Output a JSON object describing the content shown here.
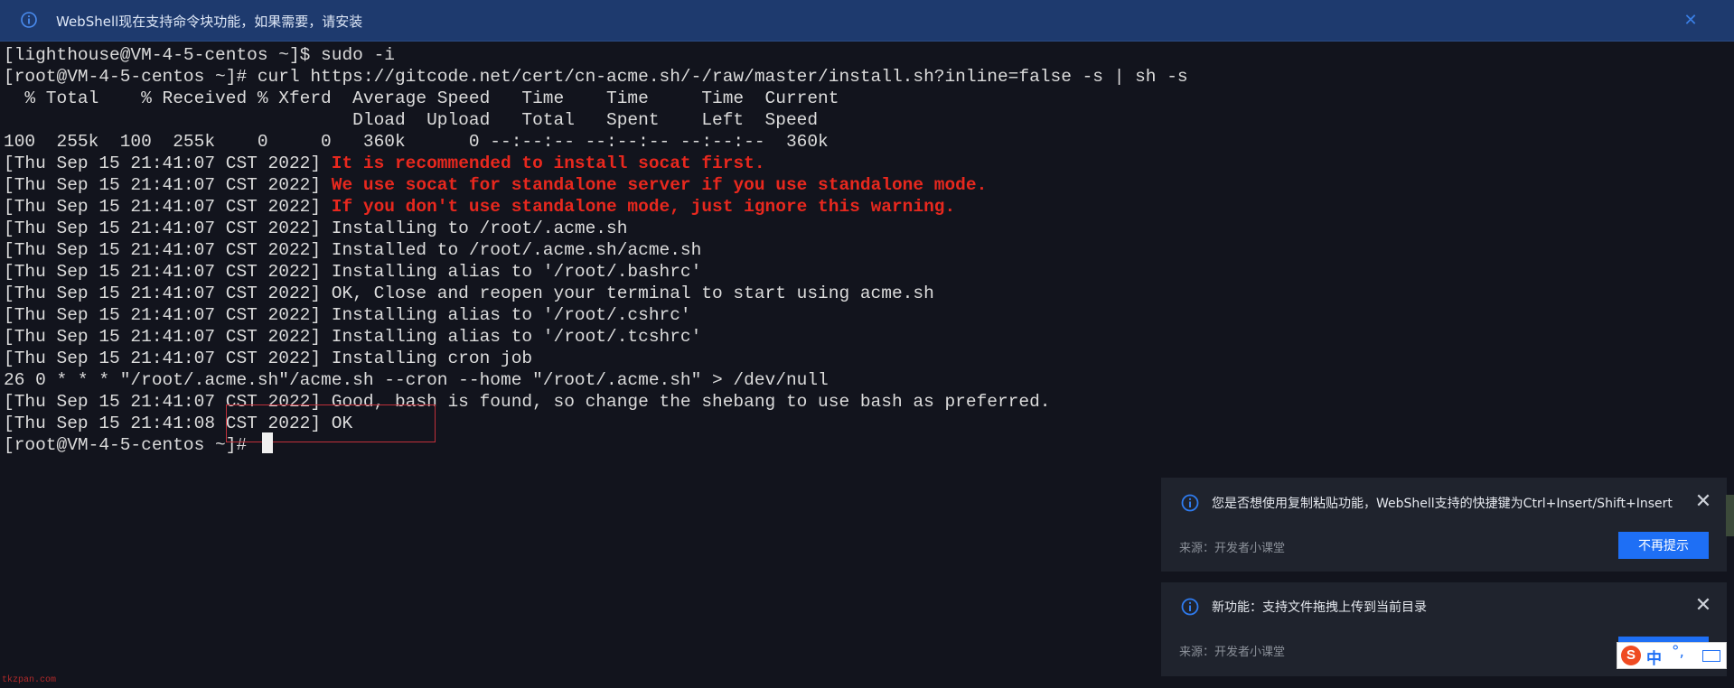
{
  "banner": {
    "message": "WebShell现在支持命令块功能，如果需要，请安装",
    "close_glyph": "✕"
  },
  "terminal": {
    "lines": [
      {
        "text": "[lighthouse@VM-4-5-centos ~]$ sudo -i"
      },
      {
        "text": "[root@VM-4-5-centos ~]# curl https://gitcode.net/cert/cn-acme.sh/-/raw/master/install.sh?inline=false -s | sh -s"
      },
      {
        "text": "  % Total    % Received % Xferd  Average Speed   Time    Time     Time  Current"
      },
      {
        "text": "                                 Dload  Upload   Total   Spent    Left  Speed"
      },
      {
        "text": "100  255k  100  255k    0     0   360k      0 --:--:-- --:--:-- --:--:--  360k"
      },
      {
        "prefix": "[Thu Sep 15 21:41:07 CST 2022] ",
        "warn": "It is recommended to install socat first."
      },
      {
        "prefix": "[Thu Sep 15 21:41:07 CST 2022] ",
        "warn": "We use socat for standalone server if you use standalone mode."
      },
      {
        "prefix": "[Thu Sep 15 21:41:07 CST 2022] ",
        "warn": "If you don't use standalone mode, just ignore this warning."
      },
      {
        "text": "[Thu Sep 15 21:41:07 CST 2022] Installing to /root/.acme.sh"
      },
      {
        "text": "[Thu Sep 15 21:41:07 CST 2022] Installed to /root/.acme.sh/acme.sh"
      },
      {
        "text": "[Thu Sep 15 21:41:07 CST 2022] Installing alias to '/root/.bashrc'"
      },
      {
        "text": "[Thu Sep 15 21:41:07 CST 2022] OK, Close and reopen your terminal to start using acme.sh"
      },
      {
        "text": "[Thu Sep 15 21:41:07 CST 2022] Installing alias to '/root/.cshrc'"
      },
      {
        "text": "[Thu Sep 15 21:41:07 CST 2022] Installing alias to '/root/.tcshrc'"
      },
      {
        "text": "[Thu Sep 15 21:41:07 CST 2022] Installing cron job"
      },
      {
        "text": "26 0 * * * \"/root/.acme.sh\"/acme.sh --cron --home \"/root/.acme.sh\" > /dev/null"
      },
      {
        "text": "[Thu Sep 15 21:41:07 CST 2022] Good, bash is found, so change the shebang to use bash as preferred."
      },
      {
        "text": "[Thu Sep 15 21:41:08 CST 2022] OK"
      },
      {
        "text": "[root@VM-4-5-centos ~]# "
      }
    ]
  },
  "toasts": [
    {
      "title": "您是否想使用复制粘贴功能，WebShell支持的快捷键为Ctrl+Insert/Shift+Insert",
      "source": "来源：开发者小课堂",
      "button": "不再提示",
      "close_glyph": "✕"
    },
    {
      "title": "新功能：支持文件拖拽上传到当前目录",
      "source": "来源：开发者小课堂",
      "button": "",
      "close_glyph": "✕"
    }
  ],
  "ime": {
    "logo": "S",
    "mode": "中",
    "punct": "°,"
  },
  "watermark": "tkzpan.com",
  "colors": {
    "terminal_bg": "#12141d",
    "terminal_text": "#dcdcdc",
    "warning": "#e8281e",
    "banner_bg": "#1e3a6e",
    "accent": "#1e6ff5",
    "toast_bg": "#1f232d",
    "highlight_border": "#c0303a"
  }
}
